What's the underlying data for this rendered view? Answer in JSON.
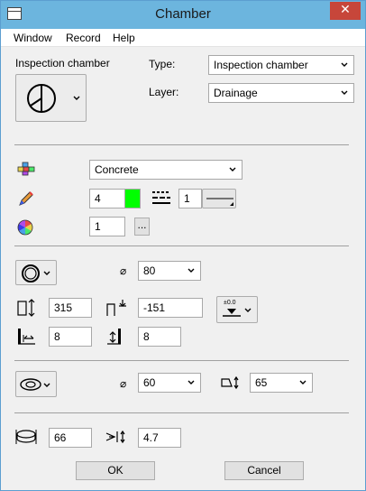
{
  "window": {
    "title": "Chamber",
    "close_glyph": "✕"
  },
  "menu": {
    "items": [
      "Window",
      "Record",
      "Help"
    ]
  },
  "header": {
    "chamber_label": "Inspection chamber",
    "type_label": "Type:",
    "type_value": "Inspection chamber",
    "layer_label": "Layer:",
    "layer_value": "Drainage",
    "chamber_icon": "chamber-symbol-icon"
  },
  "material": {
    "icon": "material-icon",
    "value": "Concrete"
  },
  "pen": {
    "icon": "pen-icon",
    "color_number": "4",
    "color": "#00ff00",
    "line_icon": "linetype-icon",
    "line_number": "1"
  },
  "layer_color": {
    "icon": "color-wheel-icon",
    "value": "1",
    "browse_label": "..."
  },
  "shaft": {
    "shape_icon": "circle-shape-icon",
    "diameter_symbol": "⌀",
    "diameter_value": "80",
    "height_icon": "height-icon",
    "height_value": "315",
    "level_icon": "level-icon",
    "level_value": "-151",
    "level_ref_label": "±0.0",
    "wall_icon": "wall-thickness-icon",
    "wall_value": "8",
    "base_icon": "base-thickness-icon",
    "base_value": "8"
  },
  "cover": {
    "shape_icon": "oval-shape-icon",
    "diameter_symbol": "⌀",
    "diameter_value": "60",
    "depth_icon": "cover-depth-icon",
    "depth_value": "65"
  },
  "frame": {
    "ring_icon": "ring-icon",
    "ring_value": "66",
    "slope_icon": "slope-icon",
    "slope_value": "4.7"
  },
  "actions": {
    "ok_label": "OK",
    "cancel_label": "Cancel"
  }
}
